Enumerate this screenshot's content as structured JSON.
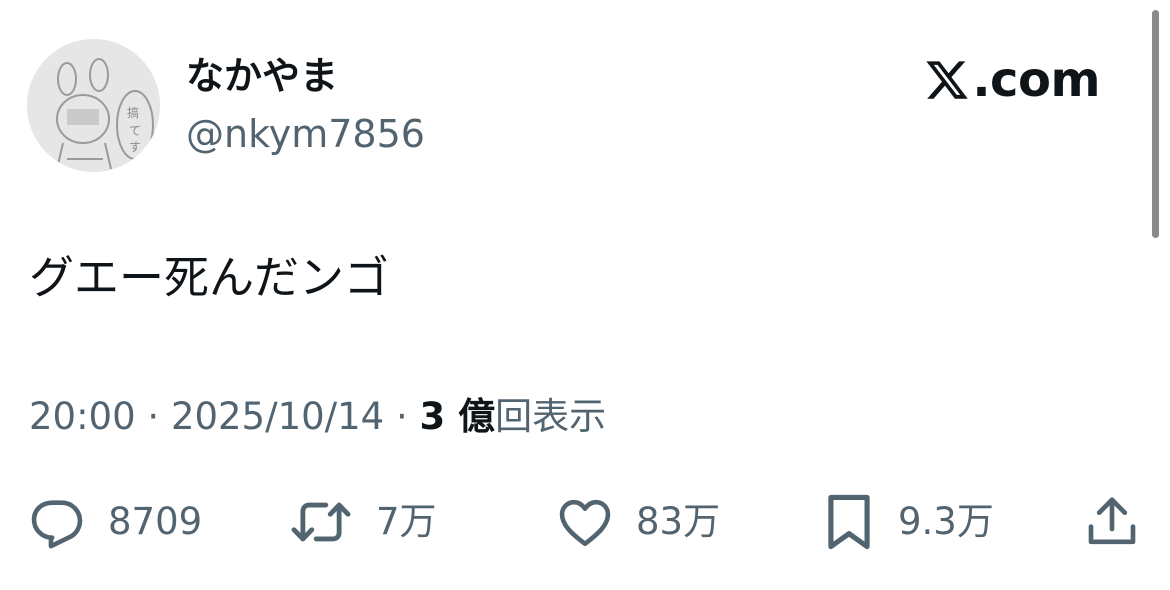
{
  "author": {
    "display_name": "なかやま",
    "handle": "@nkym7856",
    "avatar_icon": "avatar-sketch-icon"
  },
  "brand": {
    "icon": "x-logo-icon",
    "text": ".com"
  },
  "tweet": {
    "text": "グエー死んだンゴ"
  },
  "meta": {
    "time": "20:00",
    "separator1": " · ",
    "date": "2025/10/14",
    "separator2": " · ",
    "views_count": "3 億",
    "views_label": "回表示"
  },
  "actions": {
    "replies": {
      "icon": "reply-icon",
      "count": "8709"
    },
    "reposts": {
      "icon": "repost-icon",
      "count": "7万"
    },
    "likes": {
      "icon": "heart-icon",
      "count": "83万"
    },
    "bookmarks": {
      "icon": "bookmark-icon",
      "count": "9.3万"
    },
    "share": {
      "icon": "share-icon"
    }
  },
  "colors": {
    "text_primary": "#0f1419",
    "text_secondary": "#536471",
    "background": "#ffffff"
  }
}
